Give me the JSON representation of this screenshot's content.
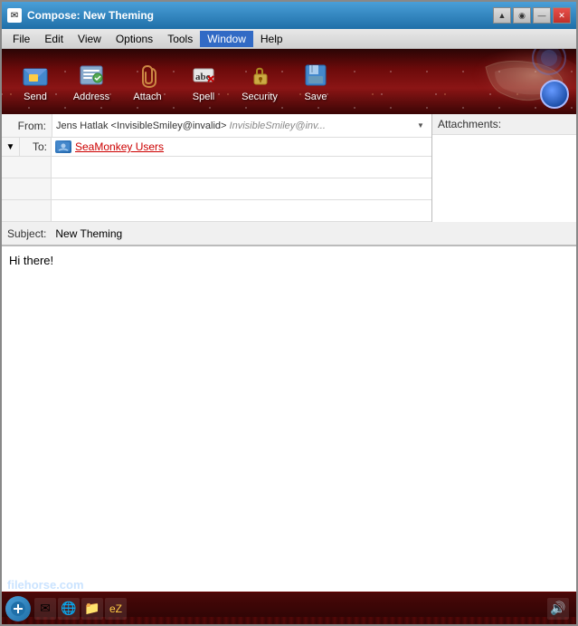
{
  "window": {
    "title": "Compose: New Theming",
    "icon": "✉"
  },
  "titlebar": {
    "controls": {
      "minimize": "▲",
      "maximize": "●",
      "restore": "—",
      "close": "✕"
    }
  },
  "menubar": {
    "items": [
      "File",
      "Edit",
      "View",
      "Options",
      "Tools",
      "Window",
      "Help"
    ]
  },
  "toolbar": {
    "buttons": [
      {
        "id": "send",
        "label": "Send",
        "icon": "📤"
      },
      {
        "id": "address",
        "label": "Address",
        "icon": "📋"
      },
      {
        "id": "attach",
        "label": "Attach",
        "icon": "📎"
      },
      {
        "id": "spell",
        "label": "Spell",
        "icon": "abc"
      },
      {
        "id": "security",
        "label": "Security",
        "icon": "🔒"
      },
      {
        "id": "save",
        "label": "Save",
        "icon": "💾"
      }
    ]
  },
  "compose": {
    "from_label": "From:",
    "from_name": "Jens Hatlak <InvisibleSmiley@invalid>",
    "from_email_gray": "InvisibleSmiley@inv...",
    "to_label": "To:",
    "recipient_name": "SeaMonkey Users",
    "subject_label": "Subject:",
    "subject_value": "New Theming",
    "attachments_label": "Attachments:",
    "body_text": "Hi there!"
  },
  "taskbar": {
    "filehorse_text": "filehorse",
    "filehorse_com": ".com"
  }
}
